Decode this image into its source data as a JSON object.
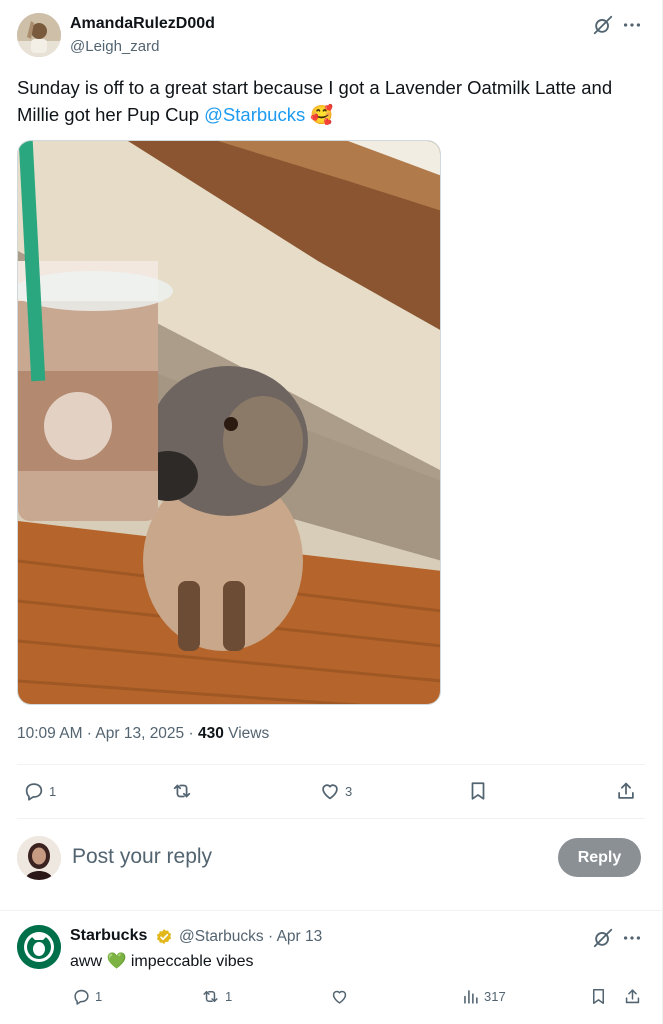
{
  "tweet": {
    "author_name": "AmandaRulezD00d",
    "author_handle": "@Leigh_zard",
    "text_before": "Sunday is off to a great start because I got a Lavender Oatmilk Latte and Millie got her Pup Cup ",
    "mention": "@Starbucks",
    "emoji": "🥰",
    "time": "10:09 AM · Apr 13, 2025 · ",
    "views_count": "430",
    "views_label": " Views",
    "replies_count": "1",
    "reposts_count": "",
    "likes_count": "3"
  },
  "composer": {
    "placeholder": "Post your reply",
    "button_label": "Reply"
  },
  "reply": {
    "author_name": "Starbucks",
    "handle_date": "@Starbucks · Apr 13",
    "text_before": "aww ",
    "emoji": "💚",
    "text_after": " impeccable vibes",
    "replies_count": "1",
    "reposts_count": "1",
    "likes_count": "",
    "views_count": "317"
  },
  "colors": {
    "accent": "#1d9bf0",
    "secondary_text": "#536471",
    "verified_gold": "#e2b719",
    "starbucks_green": "#00704a"
  },
  "icons": [
    "grok-icon",
    "more-icon",
    "reply-icon",
    "repost-icon",
    "like-icon",
    "bookmark-icon",
    "share-icon",
    "views-icon",
    "verified-badge-icon"
  ]
}
